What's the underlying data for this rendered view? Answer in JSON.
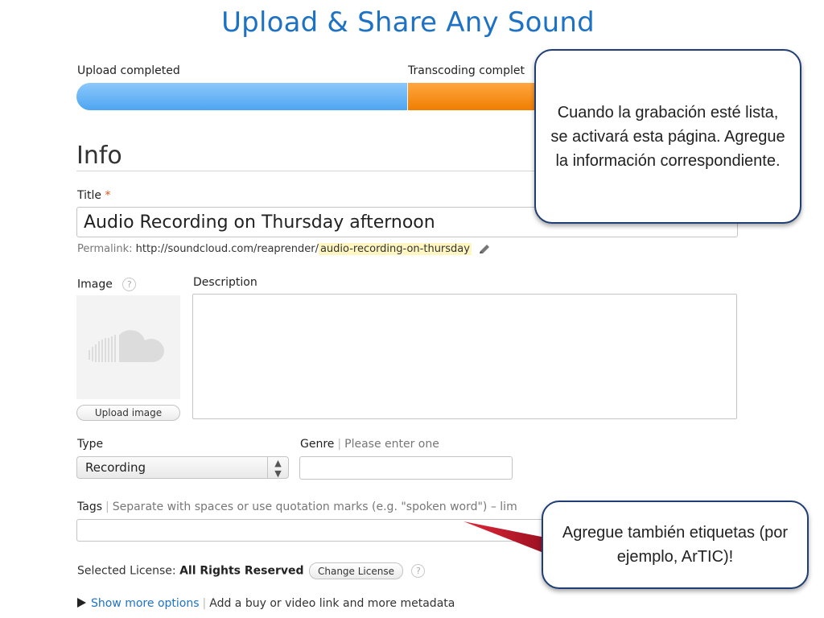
{
  "header": {
    "title": "Upload & Share Any Sound"
  },
  "progress": {
    "upload_label": "Upload completed",
    "transcode_label": "Transcoding complet",
    "upload_color": "#4ea6f1",
    "transcode_color": "#f07e00"
  },
  "info": {
    "heading": "Info",
    "title_label": "Title",
    "required_mark": "*",
    "title_value": "Audio Recording on Thursday afternoon",
    "permalink_label": "Permalink:",
    "permalink_base": "http://soundcloud.com/reaprender/",
    "permalink_slug": "audio-recording-on-thursday",
    "image_label": "Image",
    "help_glyph": "?",
    "description_label": "Description",
    "upload_image_button": "Upload image"
  },
  "type": {
    "label": "Type",
    "selected": "Recording",
    "arrows": "▲▼"
  },
  "genre": {
    "label": "Genre",
    "hint": "Please enter one"
  },
  "tags": {
    "label": "Tags",
    "hint": "Separate with spaces or use quotation marks (e.g. \"spoken word\") – lim"
  },
  "license": {
    "label": "Selected License:",
    "value": "All Rights Reserved",
    "change_button": "Change License"
  },
  "more_options": {
    "link": "Show more options",
    "hint": "Add a buy or video link and more metadata"
  },
  "callouts": {
    "first": "Cuando la grabación esté lista, se activará esta página.  Agregue la información correspondiente.",
    "second": "Agregue también etiquetas (por ejemplo, ArTIC)!"
  }
}
